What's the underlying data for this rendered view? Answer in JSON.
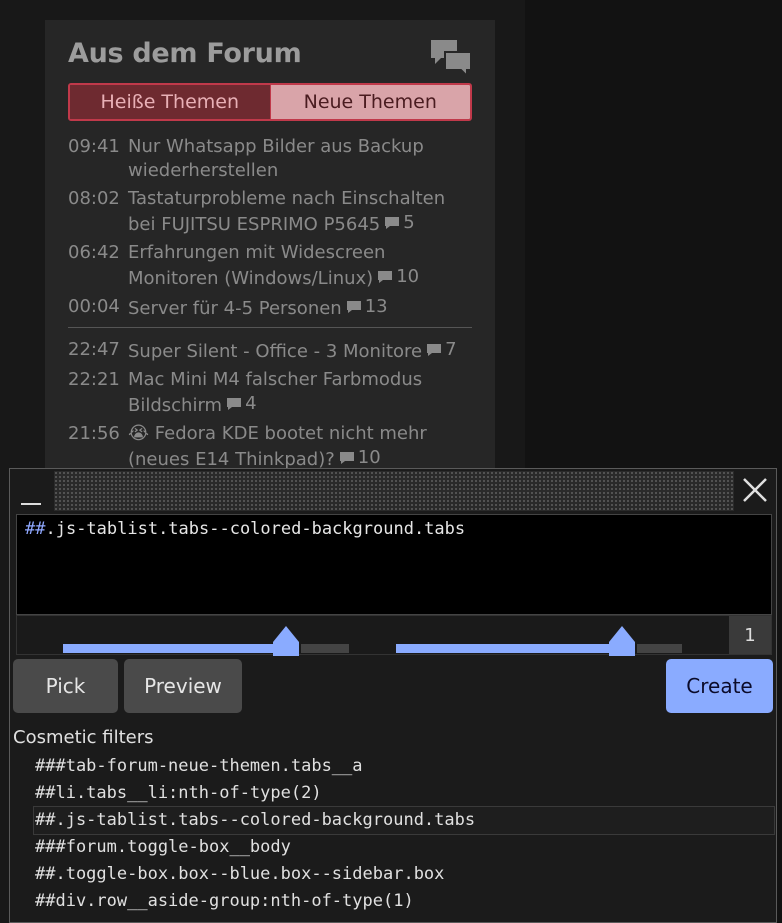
{
  "forum": {
    "title": "Aus dem Forum",
    "tabs": [
      {
        "label": "Heiße Themen",
        "active": true
      },
      {
        "label": "Neue Themen",
        "active": false
      }
    ],
    "topics_group1": [
      {
        "time": "09:41",
        "title": "Nur Whatsapp Bilder aus Backup wiederherstellen",
        "comments": ""
      },
      {
        "time": "08:02",
        "title": "Tastaturprobleme nach Einschalten bei FUJITSU ESPRIMO P5645",
        "comments": "5"
      },
      {
        "time": "06:42",
        "title": "Erfahrungen mit Widescreen Monitoren (Windows/Linux)",
        "comments": "10"
      },
      {
        "time": "00:04",
        "title": "Server für 4-5 Personen",
        "comments": "13"
      }
    ],
    "topics_group2": [
      {
        "time": "22:47",
        "title": "Super Silent - Office - 3 Monitore",
        "comments": "7"
      },
      {
        "time": "22:21",
        "title": "Mac Mini M4 falscher Farbmodus Bildschirm",
        "comments": "4"
      },
      {
        "time": "21:56",
        "title": "😭 Fedora KDE bootet nicht mehr (neues E14 Thinkpad)?",
        "comments": "10"
      }
    ]
  },
  "picker": {
    "minimize_label": "—",
    "filter_prefix": "##",
    "filter_text": ".js-tablist.tabs--colored-background.tabs",
    "match_count": "1",
    "slider_depth": 0.78,
    "slider_specificity": 0.79,
    "buttons": {
      "pick": "Pick",
      "preview": "Preview",
      "create": "Create"
    },
    "section_label": "Cosmetic filters",
    "filters": [
      {
        "text": "###tab-forum-neue-themen.tabs__a",
        "selected": false
      },
      {
        "text": "##li.tabs__li:nth-of-type(2)",
        "selected": false
      },
      {
        "text": "##.js-tablist.tabs--colored-background.tabs",
        "selected": true
      },
      {
        "text": "###forum.toggle-box__body",
        "selected": false
      },
      {
        "text": "##.toggle-box.box--blue.box--sidebar.box",
        "selected": false
      },
      {
        "text": "##div.row__aside-group:nth-of-type(1)",
        "selected": false
      }
    ]
  },
  "colors": {
    "accent": "#8aabff",
    "tab_border": "#c0394a"
  },
  "icons": {
    "forum": "chat-bubbles-icon",
    "comment": "comment-icon",
    "close": "close-icon"
  }
}
